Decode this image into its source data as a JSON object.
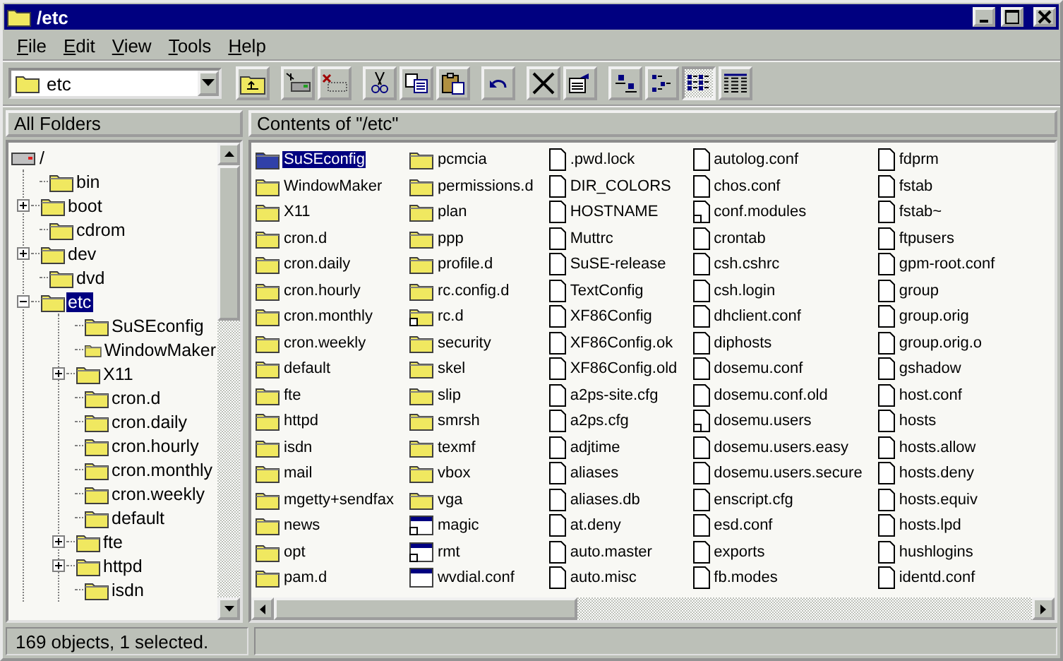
{
  "window": {
    "title": "/etc"
  },
  "menu": [
    {
      "label": "File"
    },
    {
      "label": "Edit"
    },
    {
      "label": "View"
    },
    {
      "label": "Tools"
    },
    {
      "label": "Help"
    }
  ],
  "location": {
    "value": "etc"
  },
  "view_modes": [
    {
      "selected": false
    },
    {
      "selected": false
    },
    {
      "selected": true
    },
    {
      "selected": false
    }
  ],
  "tree_header": "All Folders",
  "contents_header": "Contents of \"/etc\"",
  "tree": [
    {
      "label": "/",
      "kind": "drive",
      "selected": false,
      "children": [
        {
          "label": "bin",
          "kind": "folder",
          "selected": false
        },
        {
          "label": "boot",
          "kind": "folder",
          "selected": false,
          "expanded": false
        },
        {
          "label": "cdrom",
          "kind": "folder",
          "selected": false
        },
        {
          "label": "dev",
          "kind": "folder",
          "selected": false,
          "expanded": false
        },
        {
          "label": "dvd",
          "kind": "folder",
          "selected": false
        },
        {
          "label": "etc",
          "kind": "folder",
          "selected": true,
          "expanded": true,
          "children": [
            {
              "label": "SuSEconfig",
              "kind": "folder",
              "selected": false
            },
            {
              "label": "WindowMaker",
              "kind": "folder",
              "selected": false
            },
            {
              "label": "X11",
              "kind": "folder",
              "selected": false,
              "expanded": false
            },
            {
              "label": "cron.d",
              "kind": "folder",
              "selected": false
            },
            {
              "label": "cron.daily",
              "kind": "folder",
              "selected": false
            },
            {
              "label": "cron.hourly",
              "kind": "folder",
              "selected": false
            },
            {
              "label": "cron.monthly",
              "kind": "folder",
              "selected": false
            },
            {
              "label": "cron.weekly",
              "kind": "folder",
              "selected": false
            },
            {
              "label": "default",
              "kind": "folder",
              "selected": false
            },
            {
              "label": "fte",
              "kind": "folder",
              "selected": false,
              "expanded": false
            },
            {
              "label": "httpd",
              "kind": "folder",
              "selected": false,
              "expanded": false
            },
            {
              "label": "isdn",
              "kind": "folder",
              "selected": false
            }
          ]
        }
      ]
    }
  ],
  "files": [
    {
      "name": "SuSEconfig",
      "kind": "folder",
      "selected": true
    },
    {
      "name": "WindowMaker",
      "kind": "folder",
      "selected": false
    },
    {
      "name": "X11",
      "kind": "folder",
      "selected": false
    },
    {
      "name": "cron.d",
      "kind": "folder",
      "selected": false
    },
    {
      "name": "cron.daily",
      "kind": "folder",
      "selected": false
    },
    {
      "name": "cron.hourly",
      "kind": "folder",
      "selected": false
    },
    {
      "name": "cron.monthly",
      "kind": "folder",
      "selected": false
    },
    {
      "name": "cron.weekly",
      "kind": "folder",
      "selected": false
    },
    {
      "name": "default",
      "kind": "folder",
      "selected": false
    },
    {
      "name": "fte",
      "kind": "folder",
      "selected": false
    },
    {
      "name": "httpd",
      "kind": "folder",
      "selected": false
    },
    {
      "name": "isdn",
      "kind": "folder",
      "selected": false
    },
    {
      "name": "mail",
      "kind": "folder",
      "selected": false
    },
    {
      "name": "mgetty+sendfax",
      "kind": "folder",
      "selected": false
    },
    {
      "name": "news",
      "kind": "folder",
      "selected": false
    },
    {
      "name": "opt",
      "kind": "folder",
      "selected": false
    },
    {
      "name": "pam.d",
      "kind": "folder",
      "selected": false
    },
    {
      "name": "pcmcia",
      "kind": "folder",
      "selected": false
    },
    {
      "name": "permissions.d",
      "kind": "folder",
      "selected": false
    },
    {
      "name": "plan",
      "kind": "folder",
      "selected": false
    },
    {
      "name": "ppp",
      "kind": "folder",
      "selected": false
    },
    {
      "name": "profile.d",
      "kind": "folder",
      "selected": false
    },
    {
      "name": "rc.config.d",
      "kind": "folder",
      "selected": false
    },
    {
      "name": "rc.d",
      "kind": "folder-link",
      "selected": false
    },
    {
      "name": "security",
      "kind": "folder",
      "selected": false
    },
    {
      "name": "skel",
      "kind": "folder",
      "selected": false
    },
    {
      "name": "slip",
      "kind": "folder",
      "selected": false
    },
    {
      "name": "smrsh",
      "kind": "folder",
      "selected": false
    },
    {
      "name": "texmf",
      "kind": "folder",
      "selected": false
    },
    {
      "name": "vbox",
      "kind": "folder",
      "selected": false
    },
    {
      "name": "vga",
      "kind": "folder",
      "selected": false
    },
    {
      "name": "magic",
      "kind": "window-link",
      "selected": false
    },
    {
      "name": "rmt",
      "kind": "window-link",
      "selected": false
    },
    {
      "name": "wvdial.conf",
      "kind": "window",
      "selected": false
    },
    {
      "name": ".pwd.lock",
      "kind": "file",
      "selected": false
    },
    {
      "name": "DIR_COLORS",
      "kind": "file",
      "selected": false
    },
    {
      "name": "HOSTNAME",
      "kind": "file",
      "selected": false
    },
    {
      "name": "Muttrc",
      "kind": "file",
      "selected": false
    },
    {
      "name": "SuSE-release",
      "kind": "file",
      "selected": false
    },
    {
      "name": "TextConfig",
      "kind": "file",
      "selected": false
    },
    {
      "name": "XF86Config",
      "kind": "file",
      "selected": false
    },
    {
      "name": "XF86Config.ok",
      "kind": "file",
      "selected": false
    },
    {
      "name": "XF86Config.old",
      "kind": "file",
      "selected": false
    },
    {
      "name": "a2ps-site.cfg",
      "kind": "file",
      "selected": false
    },
    {
      "name": "a2ps.cfg",
      "kind": "file",
      "selected": false
    },
    {
      "name": "adjtime",
      "kind": "file",
      "selected": false
    },
    {
      "name": "aliases",
      "kind": "file",
      "selected": false
    },
    {
      "name": "aliases.db",
      "kind": "file",
      "selected": false
    },
    {
      "name": "at.deny",
      "kind": "file",
      "selected": false
    },
    {
      "name": "auto.master",
      "kind": "file",
      "selected": false
    },
    {
      "name": "auto.misc",
      "kind": "file",
      "selected": false
    },
    {
      "name": "autolog.conf",
      "kind": "file",
      "selected": false
    },
    {
      "name": "chos.conf",
      "kind": "file",
      "selected": false
    },
    {
      "name": "conf.modules",
      "kind": "file-link",
      "selected": false
    },
    {
      "name": "crontab",
      "kind": "file",
      "selected": false
    },
    {
      "name": "csh.cshrc",
      "kind": "file",
      "selected": false
    },
    {
      "name": "csh.login",
      "kind": "file",
      "selected": false
    },
    {
      "name": "dhclient.conf",
      "kind": "file",
      "selected": false
    },
    {
      "name": "diphosts",
      "kind": "file",
      "selected": false
    },
    {
      "name": "dosemu.conf",
      "kind": "file",
      "selected": false
    },
    {
      "name": "dosemu.conf.old",
      "kind": "file",
      "selected": false
    },
    {
      "name": "dosemu.users",
      "kind": "file-link",
      "selected": false
    },
    {
      "name": "dosemu.users.easy",
      "kind": "file",
      "selected": false
    },
    {
      "name": "dosemu.users.secure",
      "kind": "file",
      "selected": false
    },
    {
      "name": "enscript.cfg",
      "kind": "file",
      "selected": false
    },
    {
      "name": "esd.conf",
      "kind": "file",
      "selected": false
    },
    {
      "name": "exports",
      "kind": "file",
      "selected": false
    },
    {
      "name": "fb.modes",
      "kind": "file",
      "selected": false
    },
    {
      "name": "fdprm",
      "kind": "file",
      "selected": false
    },
    {
      "name": "fstab",
      "kind": "file",
      "selected": false
    },
    {
      "name": "fstab~",
      "kind": "file",
      "selected": false
    },
    {
      "name": "ftpusers",
      "kind": "file",
      "selected": false
    },
    {
      "name": "gpm-root.conf",
      "kind": "file",
      "selected": false
    },
    {
      "name": "group",
      "kind": "file",
      "selected": false
    },
    {
      "name": "group.orig",
      "kind": "file",
      "selected": false
    },
    {
      "name": "group.orig.o",
      "kind": "file",
      "selected": false
    },
    {
      "name": "gshadow",
      "kind": "file",
      "selected": false
    },
    {
      "name": "host.conf",
      "kind": "file",
      "selected": false
    },
    {
      "name": "hosts",
      "kind": "file",
      "selected": false
    },
    {
      "name": "hosts.allow",
      "kind": "file",
      "selected": false
    },
    {
      "name": "hosts.deny",
      "kind": "file",
      "selected": false
    },
    {
      "name": "hosts.equiv",
      "kind": "file",
      "selected": false
    },
    {
      "name": "hosts.lpd",
      "kind": "file",
      "selected": false
    },
    {
      "name": "hushlogins",
      "kind": "file",
      "selected": false
    },
    {
      "name": "identd.conf",
      "kind": "file",
      "selected": false
    }
  ],
  "status_bar": {
    "text": "169 objects, 1 selected."
  }
}
